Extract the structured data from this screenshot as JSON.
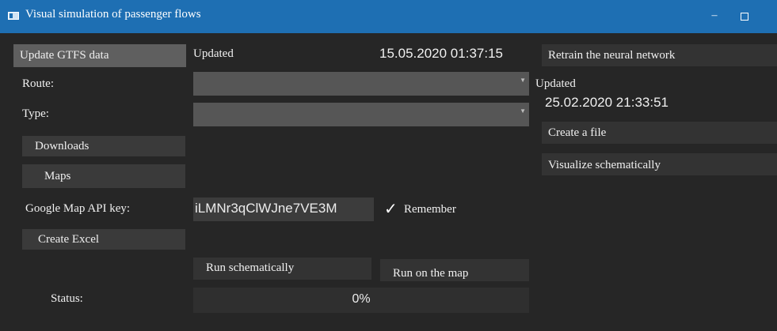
{
  "window": {
    "title": "Visual simulation of passenger flows",
    "minimize_glyph": "–",
    "title_icon": "app-window-icon"
  },
  "left": {
    "update_gtfs_label": "Update GTFS data",
    "route_label": "Route:",
    "type_label": "Type:",
    "downloads_label": "Downloads",
    "maps_label": "Maps",
    "api_key_label": "Google Map API key:",
    "create_excel_label": "Create Excel",
    "status_label": "Status:"
  },
  "middle": {
    "updated_label": "Updated",
    "gtfs_timestamp": "15.05.2020 01:37:15",
    "route_value": "",
    "type_value": "",
    "api_key_value": "iLMNr3qClWJne7VE3M",
    "remember_check": "✓",
    "remember_label": "Remember",
    "run_schematically_label": "Run schematically",
    "run_on_map_label": "Run on the map",
    "progress_text": "0%",
    "progress_value": 0
  },
  "right": {
    "retrain_label": "Retrain the neural network",
    "updated_label": "Updated",
    "nn_timestamp": "25.02.2020 21:33:51",
    "create_file_label": "Create a file",
    "visualize_label": "Visualize schematically"
  }
}
